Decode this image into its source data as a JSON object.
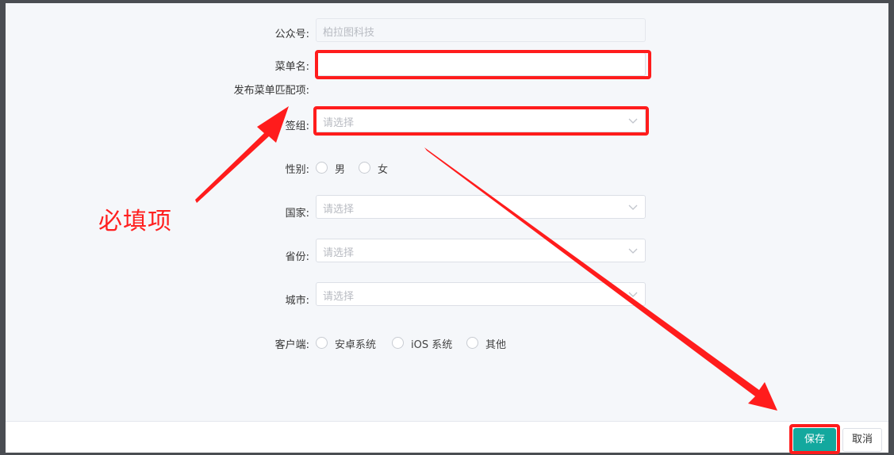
{
  "form": {
    "account_label": "公众号:",
    "account_value": "柏拉图科技",
    "menu_name_label": "菜单名:",
    "match_section_label": "发布菜单匹配项:",
    "tag_group_label": "签组:",
    "tag_group_placeholder": "请选择",
    "gender_label": "性别:",
    "gender_options": [
      "男",
      "女"
    ],
    "country_label": "国家:",
    "country_placeholder": "请选择",
    "province_label": "省份:",
    "province_placeholder": "请选择",
    "city_label": "城市:",
    "city_placeholder": "请选择",
    "client_label": "客户端:",
    "client_options": [
      "安卓系统",
      "iOS 系统",
      "其他"
    ]
  },
  "footer": {
    "save_label": "保存",
    "cancel_label": "取消"
  },
  "annotation": {
    "text": "必填项",
    "color": "#ff2020"
  },
  "colors": {
    "accent": "#13a89e",
    "highlight": "#ff1c1c"
  }
}
